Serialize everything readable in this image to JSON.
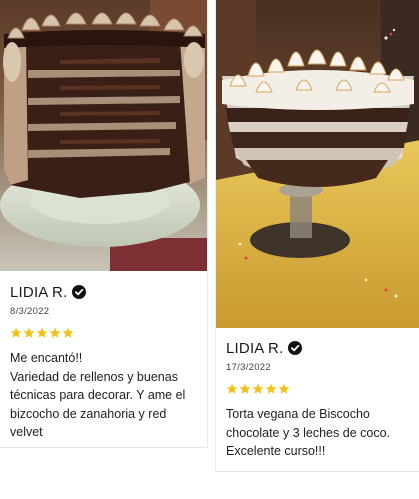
{
  "reviews": [
    {
      "photo": "chocolate-layer-cake-photo",
      "name": "LIDIA R.",
      "date": "8/3/2022",
      "rating": 5,
      "text": "Me encantó!!\nVariedad de rellenos y buenas técnicas para decorar. Y ame el bizcocho de zanahoria y red velvet"
    },
    {
      "photo": "trifle-meringue-dessert-photo",
      "name": "LIDIA R.",
      "date": "17/3/2022",
      "rating": 5,
      "text": "Torta vegana de Biscocho chocolate y 3 leches de coco. Excelente curso!!!"
    }
  ],
  "colors": {
    "star": "#f2c21b",
    "verified": "#111111"
  },
  "icons": {
    "verified": "verified-check-icon",
    "star": "star-icon"
  }
}
